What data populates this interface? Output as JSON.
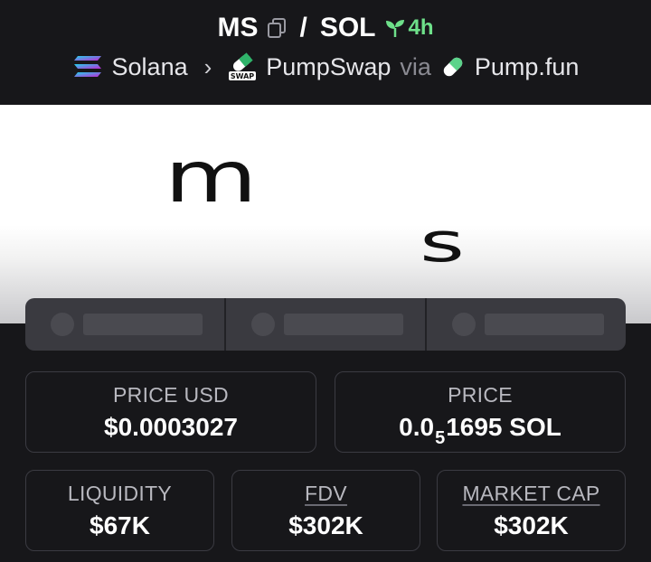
{
  "header": {
    "base_symbol": "MS",
    "separator": "/",
    "quote_symbol": "SOL",
    "age": "4h",
    "chain": "Solana",
    "dex": "PumpSwap",
    "via_label": "via",
    "launchpad": "Pump.fun",
    "dex_badge_text": "SWAP"
  },
  "banner": {
    "letter_1": "m",
    "letter_2": "s"
  },
  "stats": {
    "price_usd": {
      "label": "PRICE USD",
      "value": "$0.0003027"
    },
    "price": {
      "label": "PRICE",
      "value_prefix": "0.0",
      "value_sub": "5",
      "value_rest": "1695 SOL"
    },
    "liquidity": {
      "label": "LIQUIDITY",
      "value": "$67K"
    },
    "fdv": {
      "label": "FDV",
      "value": "$302K"
    },
    "market_cap": {
      "label": "MARKET CAP",
      "value": "$302K"
    }
  },
  "colors": {
    "background": "#17171a",
    "age_green": "#6ee08a",
    "card_border": "#3b3b42",
    "socials_bg": "#3a3a40"
  }
}
